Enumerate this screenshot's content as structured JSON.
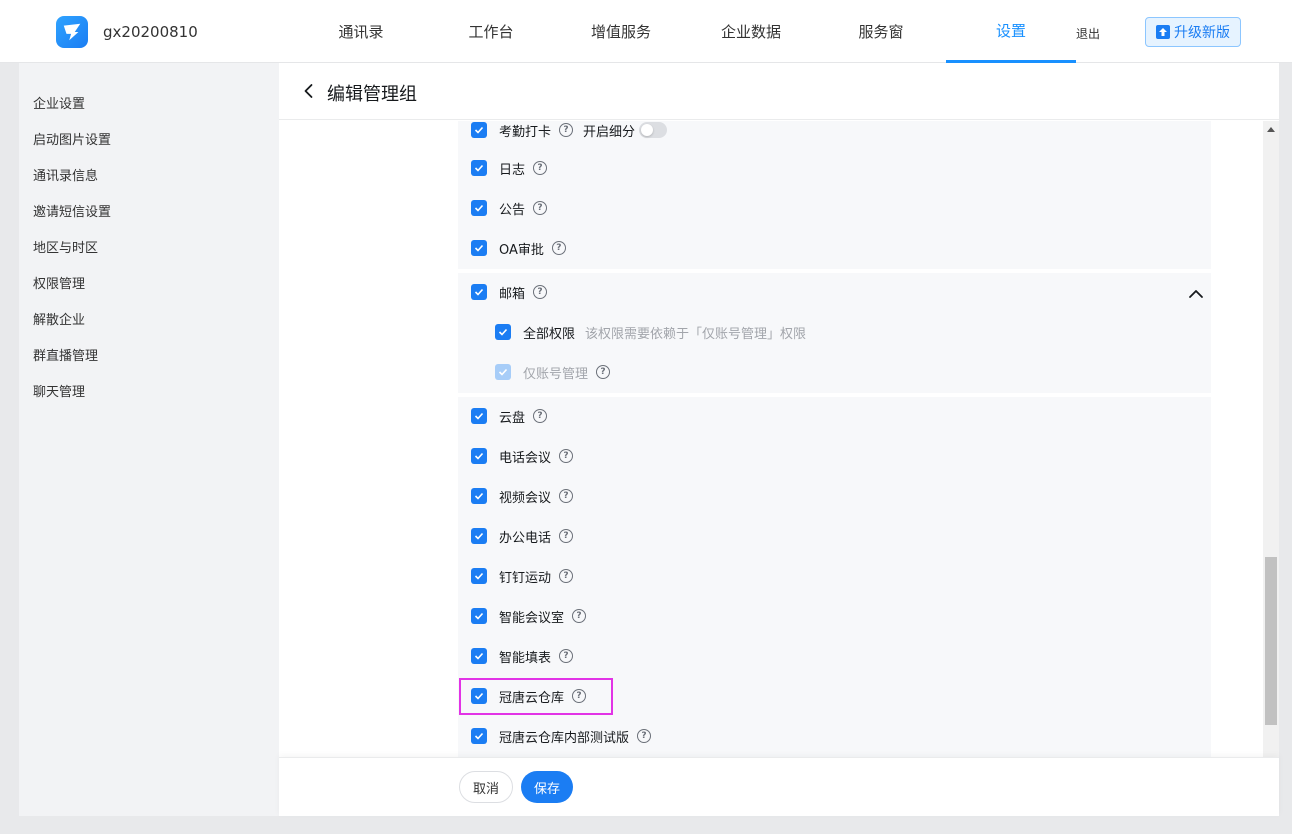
{
  "header": {
    "org_name": "gx20200810",
    "nav": [
      "通讯录",
      "工作台",
      "增值服务",
      "企业数据",
      "服务窗",
      "设置"
    ],
    "active_nav": "设置",
    "logout": "退出",
    "upgrade": "升级新版"
  },
  "sidebar": {
    "items": [
      "企业设置",
      "启动图片设置",
      "通讯录信息",
      "邀请短信设置",
      "地区与时区",
      "权限管理",
      "解散企业",
      "群直播管理",
      "聊天管理"
    ]
  },
  "page": {
    "title": "编辑管理组"
  },
  "permissions": {
    "group1": [
      {
        "label": "考勤打卡",
        "extra": "开启细分",
        "toggle": false
      },
      {
        "label": "日志"
      },
      {
        "label": "公告"
      },
      {
        "label": "OA审批"
      }
    ],
    "mail": {
      "label": "邮箱",
      "expanded": true,
      "children": [
        {
          "label": "全部权限",
          "note": "该权限需要依赖于「仅账号管理」权限",
          "checked": true
        },
        {
          "label": "仅账号管理",
          "checked": true,
          "disabled": true
        }
      ]
    },
    "group3": [
      {
        "label": "云盘"
      },
      {
        "label": "电话会议"
      },
      {
        "label": "视频会议"
      },
      {
        "label": "办公电话"
      },
      {
        "label": "钉钉运动"
      },
      {
        "label": "智能会议室"
      },
      {
        "label": "智能填表"
      },
      {
        "label": "冠唐云仓库"
      },
      {
        "label": "冠唐云仓库内部测试版"
      }
    ]
  },
  "footer": {
    "cancel": "取消",
    "save": "保存"
  },
  "colors": {
    "primary": "#1b7df3",
    "highlight": "#e233e6"
  }
}
